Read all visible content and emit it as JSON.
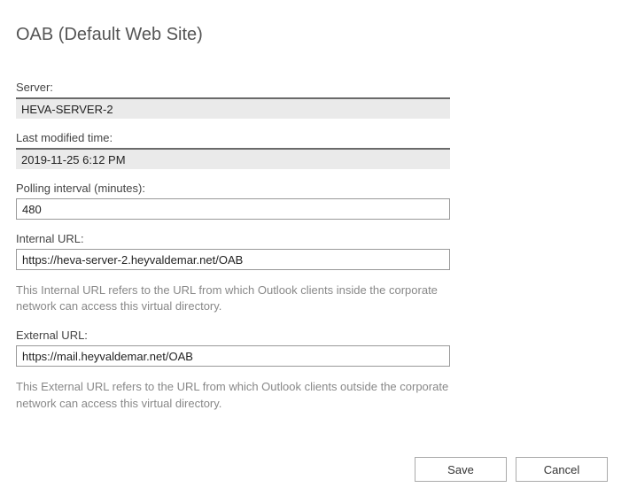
{
  "title": "OAB (Default Web Site)",
  "fields": {
    "server": {
      "label": "Server:",
      "value": "HEVA-SERVER-2"
    },
    "lastModified": {
      "label": "Last modified time:",
      "value": "2019-11-25 6:12 PM"
    },
    "pollingInterval": {
      "label": "Polling interval (minutes):",
      "value": "480"
    },
    "internalUrl": {
      "label": "Internal URL:",
      "value": "https://heva-server-2.heyvaldemar.net/OAB",
      "help": "This Internal URL refers to the URL from which Outlook clients inside the corporate network can access this virtual directory."
    },
    "externalUrl": {
      "label": "External URL:",
      "value": "https://mail.heyvaldemar.net/OAB",
      "help": "This External URL refers to the URL from which Outlook clients outside the corporate network can access this virtual directory."
    }
  },
  "buttons": {
    "save": "Save",
    "cancel": "Cancel"
  }
}
